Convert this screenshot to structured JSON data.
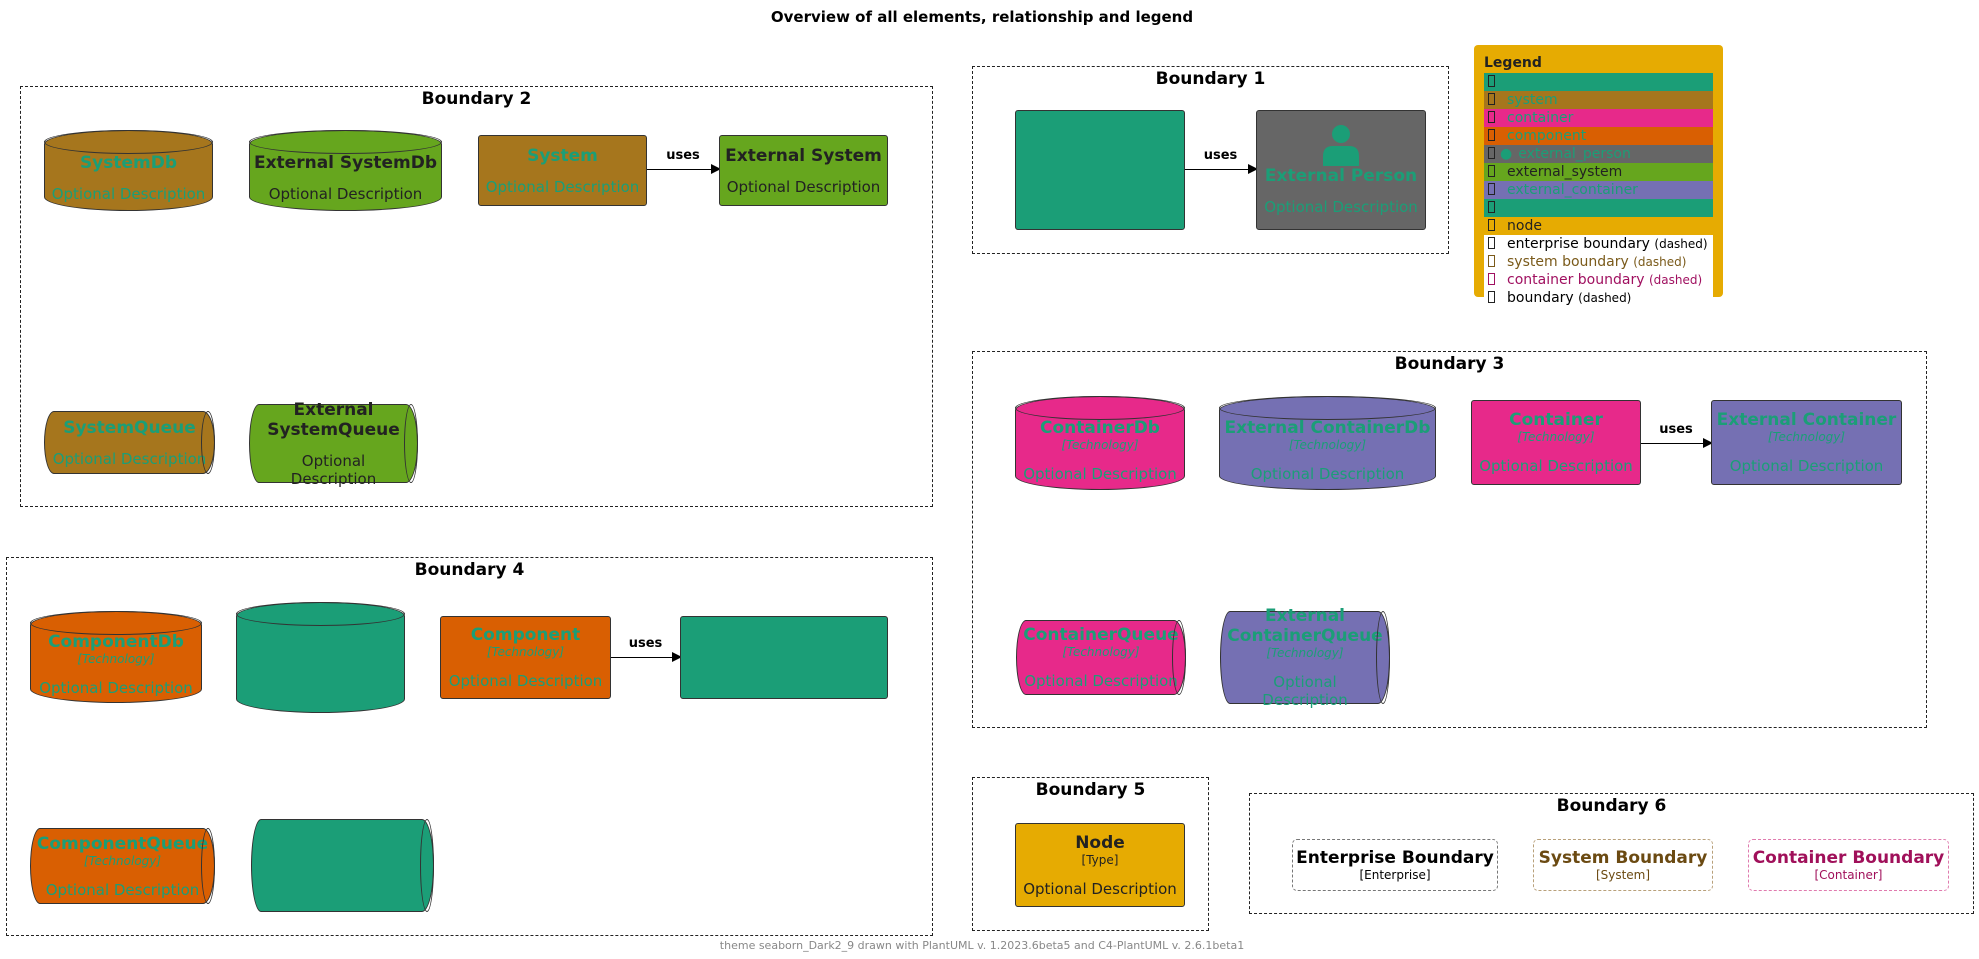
{
  "title": "Overview of all elements, relationship and legend",
  "footer": "theme seaborn_Dark2_9 drawn with PlantUML v. 1.2023.6beta5 and C4-PlantUML v. 2.6.1beta1",
  "relation_label": "uses",
  "colors": {
    "teal": "#1b9e77",
    "system": "#a6761d",
    "container": "#e7298a",
    "component": "#d95f02",
    "external_person": "#666666",
    "external_system": "#66a61e",
    "external_container": "#7570b3",
    "node": "#e6ab02"
  },
  "boundaries": {
    "b1": "Boundary 1",
    "b2": "Boundary 2",
    "b3": "Boundary 3",
    "b4": "Boundary 4",
    "b5": "Boundary 5",
    "b6": "Boundary 6"
  },
  "elements": {
    "system_db": {
      "name": "SystemDb",
      "desc": "Optional Description"
    },
    "ext_system_db": {
      "name": "External SystemDb",
      "desc": "Optional Description"
    },
    "system": {
      "name": "System",
      "desc": "Optional Description"
    },
    "ext_system": {
      "name": "External System",
      "desc": "Optional Description"
    },
    "system_queue": {
      "name": "SystemQueue",
      "desc": "Optional Description"
    },
    "ext_system_queue": {
      "name": "External SystemQueue",
      "desc": "Optional Description"
    },
    "ext_person": {
      "name": "External Person",
      "desc": "Optional Description"
    },
    "container_db": {
      "name": "ContainerDb",
      "tech": "[Technology]",
      "desc": "Optional Description"
    },
    "ext_container_db": {
      "name": "External ContainerDb",
      "tech": "[Technology]",
      "desc": "Optional Description"
    },
    "container": {
      "name": "Container",
      "tech": "[Technology]",
      "desc": "Optional Description"
    },
    "ext_container": {
      "name": "External Container",
      "tech": "[Technology]",
      "desc": "Optional Description"
    },
    "container_queue": {
      "name": "ContainerQueue",
      "tech": "[Technology]",
      "desc": "Optional Description"
    },
    "ext_container_queue": {
      "name": "External ContainerQueue",
      "tech": "[Technology]",
      "desc": "Optional Description"
    },
    "component_db": {
      "name": "ComponentDb",
      "tech": "[Technology]",
      "desc": "Optional Description"
    },
    "component": {
      "name": "Component",
      "tech": "[Technology]",
      "desc": "Optional Description"
    },
    "component_queue": {
      "name": "ComponentQueue",
      "tech": "[Technology]",
      "desc": "Optional Description"
    },
    "node": {
      "name": "Node",
      "tech": "[Type]",
      "desc": "Optional Description"
    },
    "enterprise_boundary": {
      "name": "Enterprise Boundary",
      "tech": "[Enterprise]"
    },
    "system_boundary": {
      "name": "System Boundary",
      "tech": "[System]"
    },
    "container_boundary": {
      "name": "Container Boundary",
      "tech": "[Container]"
    }
  },
  "legend": {
    "title": "Legend",
    "items": [
      "",
      "system",
      "container",
      "component",
      "external_person",
      "external_system",
      "external_container",
      "",
      "node",
      "enterprise boundary",
      "system boundary",
      "container boundary",
      "boundary"
    ],
    "dashed": "(dashed)"
  }
}
